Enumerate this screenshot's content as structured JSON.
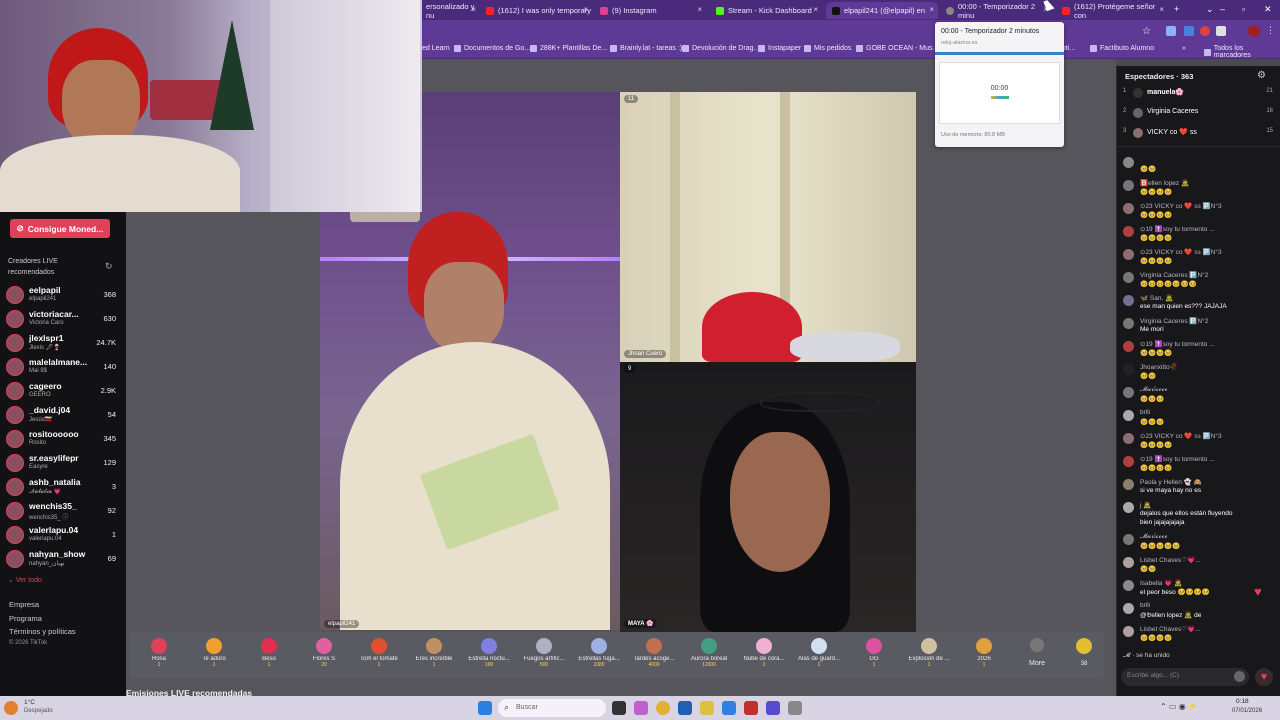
{
  "browser": {
    "tabs": [
      {
        "label": "ersonalizado y nu",
        "color": "#ff4040"
      },
      {
        "label": "(1612) I was only temporary",
        "color": "#ff2020"
      },
      {
        "label": "(9) Instagram",
        "color": "#e04090"
      },
      {
        "label": "Stream - Kick Dashboard",
        "color": "#53fc18"
      },
      {
        "label": "elpapil241 (@elpapil) en",
        "color": "#111111"
      },
      {
        "label": "00:00 - Temporizador 2 minu",
        "color": "#888888"
      },
      {
        "label": "(1612) Protégeme señor con",
        "color": "#ff2020"
      }
    ],
    "bookmarks": [
      "ed Learn",
      "Documentos de Go...",
      "288K+ Plantillas De...",
      "Brainly.lat - tareas :)",
      "Devolución de Drag...",
      "Instapaper",
      "Mis pedidos",
      "GOBE OCEAN - Mus...",
      "oti...",
      "Factibuto Alumno",
      "Todos los marcadores"
    ],
    "new_tab": "+"
  },
  "timer_popup": {
    "title": "00:00 - Temporizador 2 minutos",
    "url": "reloj-alarma.es",
    "time": "00:00",
    "footer": "Uso de memoria: 80.8 MB"
  },
  "sidebar": {
    "coins_button": "Consigue Moned...",
    "section_title": "Creadores LIVE recomendados",
    "creators": [
      {
        "name": "eelpapil",
        "sub": "elpapil241",
        "count": "368"
      },
      {
        "name": "victoriacar...",
        "sub": "Victoria Caro",
        "count": "630"
      },
      {
        "name": "jlexlspr1",
        "sub": "Jlexis 🖋🍷",
        "count": "24.7K"
      },
      {
        "name": "malelalmane...",
        "sub": "Mai 8$",
        "count": "140"
      },
      {
        "name": "cageero",
        "sub": "GEERO",
        "count": "2.9K"
      },
      {
        "name": "_david.j04",
        "sub": "Jesús🇻🇪",
        "count": "54"
      },
      {
        "name": "rositoooooo",
        "sub": "Rosito",
        "count": "345"
      },
      {
        "name": "sr.easylifepr",
        "sub": "Easyre",
        "count": "129"
      },
      {
        "name": "ashb_natalia",
        "sub": "𝓝𝓪𝓽𝓪𝓵𝓲𝓪 💗",
        "count": "3"
      },
      {
        "name": "wenchis35_",
        "sub": "wenchis35_ ⓘ",
        "count": "92"
      },
      {
        "name": "valerlapu.04",
        "sub": "valeriapu.04",
        "count": "1"
      },
      {
        "name": "nahyan_show",
        "sub": "nahyan_نهيان",
        "count": "69"
      }
    ],
    "see_all": "Ver todo",
    "footer": [
      "Empresa",
      "Programa",
      "Términos y políticas",
      "© 2026 TikTok"
    ]
  },
  "stage": {
    "host_label": "elpapil241",
    "guest1_label": "Jhoan Cuero",
    "guest2_label": "MAYA 🌸",
    "guest1_count": "11",
    "guest2_count": "9",
    "recommended_title": "Emisiones LIVE recomendadas"
  },
  "gifts": [
    {
      "name": "Rosa",
      "price": "1",
      "icon": "rose-icon",
      "color": "#e0405a"
    },
    {
      "name": "Te adoro",
      "price": "1",
      "icon": "heart-face-icon",
      "color": "#f0a030"
    },
    {
      "name": "Beso",
      "price": "1",
      "icon": "lips-icon",
      "color": "#e03050"
    },
    {
      "name": "Flores S",
      "price": "20",
      "icon": "flowers-icon",
      "color": "#e060a0"
    },
    {
      "name": "Tom el tomate",
      "price": "1",
      "icon": "tomato-icon",
      "color": "#e05030"
    },
    {
      "name": "Eres increíble",
      "price": "1",
      "icon": "dog-icon",
      "color": "#c09060"
    },
    {
      "name": "Estrella noctu...",
      "price": "199",
      "icon": "ghost-icon",
      "color": "#8080e0"
    },
    {
      "name": "Fuegos artific...",
      "price": "500",
      "icon": "firework-icon",
      "color": "#b0b0c0"
    },
    {
      "name": "Estrellas fuga...",
      "price": "1080",
      "icon": "star-icon",
      "color": "#a0b0e0"
    },
    {
      "name": "Tardes acoge...",
      "price": "4000",
      "icon": "house-icon",
      "color": "#c07050"
    },
    {
      "name": "Aurora boreal",
      "price": "12000",
      "icon": "aurora-icon",
      "color": "#40a080"
    },
    {
      "name": "Nube de cora...",
      "price": "1",
      "icon": "cloud-heart-icon",
      "color": "#f0b0d0"
    },
    {
      "name": "Alas de guard...",
      "price": "1",
      "icon": "wings-icon",
      "color": "#d0e0f0"
    },
    {
      "name": "GG",
      "price": "1",
      "icon": "gg-icon",
      "color": "#e050a0"
    },
    {
      "name": "Explosión de ...",
      "price": "1",
      "icon": "explosion-icon",
      "color": "#d0c0a0"
    },
    {
      "name": "2026",
      "price": "1",
      "icon": "year-icon",
      "color": "#e0a040"
    }
  ],
  "gifts_more": "More",
  "coins_balance": "38",
  "chat": {
    "title": "Espectadores · 363",
    "top": [
      {
        "rank": "1",
        "name": "manuela🌸",
        "score": "21"
      },
      {
        "rank": "2",
        "name": "Virginia Caceres",
        "score": "16"
      },
      {
        "rank": "3",
        "name": "VICKY co ❤️ ss",
        "score": "15"
      }
    ],
    "messages": [
      {
        "name": "",
        "text": "🥺🥺",
        "avatar": "#888"
      },
      {
        "name": "🅱️ellen lopez 🧟",
        "text": "🥺🥺🥺🥺",
        "avatar": "#777"
      },
      {
        "name": "⊙23 VICKY co ❤️ ss 🅿️N°3",
        "text": "🥺🥺🥺🥺",
        "avatar": "#8a7070"
      },
      {
        "name": "⊙19 ✝️soy tu tormento ...",
        "text": "🥺🥺🥺🥺",
        "avatar": "#b04040"
      },
      {
        "name": "⊙23 VICKY co ❤️ ss 🅿️N°3",
        "text": "🥺🥺🥺🥺",
        "avatar": "#8a7070"
      },
      {
        "name": "Virginia Caceres 🅿️N°2",
        "text": "🥺🥺🥺🥺🥺🥺🥺",
        "avatar": "#777"
      },
      {
        "name": "🦋 San. 🧟",
        "text": "ese man quien es??? JAJAJA",
        "avatar": "#707090"
      },
      {
        "name": "Virginia Caceres 🅿️N°2",
        "text": "Me morí",
        "avatar": "#777"
      },
      {
        "name": "⊙19 ✝️soy tu tormento ...",
        "text": "🥺🥺🥺🥺",
        "avatar": "#b04040"
      },
      {
        "name": "Jhoanxitto🥀",
        "text": "🥺🥺",
        "avatar": "#222"
      },
      {
        "name": "𝓜𝓪𝓻í𝓬𝓸𝓬𝓸",
        "text": "🥺🥺🥺",
        "avatar": "#777"
      },
      {
        "name": "brlli",
        "text": "🥺🥺🥺",
        "avatar": "#aaa"
      },
      {
        "name": "⊙23 VICKY co ❤️ ss 🅿️N°3",
        "text": "🥺🥺🥺🥺",
        "avatar": "#8a7070"
      },
      {
        "name": "⊙19 ✝️soy tu tormento ...",
        "text": "🥺🥺🥺🥺",
        "avatar": "#b04040"
      },
      {
        "name": "Paola y Hellen 👻 🙈",
        "text": "si ve maya hay no es",
        "avatar": "#8a8070"
      },
      {
        "name": "j 🧟",
        "text": "dejalos que ellos están fluyendo",
        "text2": "bien jajajajajaja",
        "avatar": "#aaa"
      },
      {
        "name": "𝓜𝓪𝓻í𝓬𝓸𝓬𝓸",
        "text": "🥺🥺🥺🥺🥺",
        "avatar": "#777"
      },
      {
        "name": "Lisbet Chaves♡💗...",
        "text": "🥺🥺",
        "avatar": "#b0a0a0"
      },
      {
        "name": "Isabella 💗 🧟",
        "text": "el peor beso 🥺🥺🥺🥺",
        "avatar": "#8a8a8a"
      },
      {
        "name": "brlli",
        "text": "@𝔅ellen lopez 🧟 de",
        "avatar": "#aaa"
      },
      {
        "name": "Lisbet Chaves♡💗...",
        "text": "🥺🥺🥺🥺",
        "avatar": "#b0a0a0"
      }
    ],
    "joined": "se ha unido",
    "joined_name": "𝓜",
    "input_placeholder": "Escribe algo... (C)"
  },
  "taskbar": {
    "weather": "1°C",
    "weather_sub": "Despejado",
    "search": "Buscar",
    "time": "0:18",
    "date": "07/01/2026"
  }
}
